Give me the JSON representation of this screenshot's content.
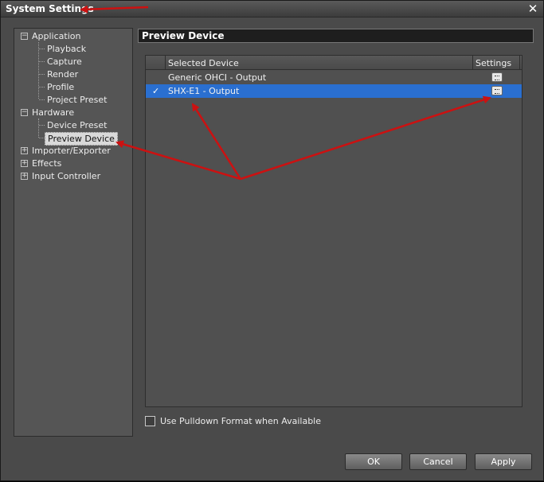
{
  "window": {
    "title": "System Settings",
    "close_glyph": "✕"
  },
  "tree": {
    "nodes": [
      {
        "label": "Application",
        "level": 0,
        "toggle": "−"
      },
      {
        "label": "Playback",
        "level": 1
      },
      {
        "label": "Capture",
        "level": 1
      },
      {
        "label": "Render",
        "level": 1
      },
      {
        "label": "Profile",
        "level": 1
      },
      {
        "label": "Project Preset",
        "level": 1
      },
      {
        "label": "Hardware",
        "level": 0,
        "toggle": ""
      },
      {
        "label": "Device Preset",
        "level": 1
      },
      {
        "label": "Preview Device",
        "level": 1,
        "selected": true
      },
      {
        "label": "Importer/Exporter",
        "level": 0,
        "toggle": "+"
      },
      {
        "label": "Effects",
        "level": 0,
        "toggle": "+"
      },
      {
        "label": "Input Controller",
        "level": 0,
        "toggle": "+"
      }
    ]
  },
  "panel": {
    "title": "Preview Device",
    "columns": {
      "device": "Selected Device",
      "settings": "Settings"
    },
    "rows": [
      {
        "label": "Generic OHCI - Output",
        "checked": false,
        "settings_icon": "settings-icon"
      },
      {
        "label": "SHX-E1 - Output",
        "checked": true,
        "check_glyph": "✓",
        "settings_icon": "settings-icon"
      }
    ]
  },
  "options": {
    "pulldown_label": "Use Pulldown Format when Available",
    "pulldown_checked": false
  },
  "buttons": {
    "ok": "OK",
    "cancel": "Cancel",
    "apply": "Apply"
  },
  "colors": {
    "selection": "#2a6fd0",
    "annotation_arrows": "#cc1111"
  }
}
